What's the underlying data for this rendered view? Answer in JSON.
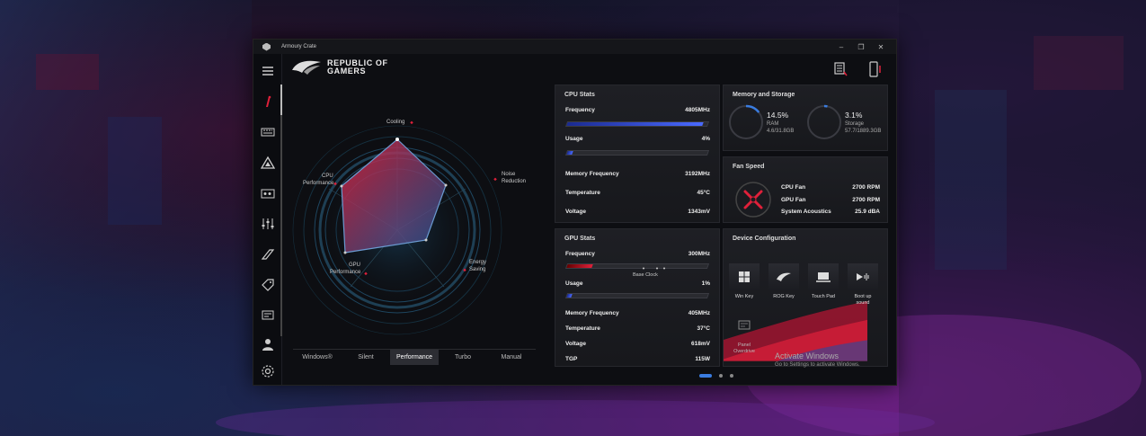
{
  "window": {
    "title": "Armoury Crate",
    "controls": [
      "–",
      "❐",
      "✕"
    ]
  },
  "brand": {
    "line1": "REPUBLIC OF",
    "line2": "GAMERS"
  },
  "sidebar": {
    "items": [
      {
        "icon": "menu-icon"
      },
      {
        "icon": "home-icon"
      },
      {
        "icon": "keyboard-icon"
      },
      {
        "icon": "aura-icon"
      },
      {
        "icon": "gamevisual-icon"
      },
      {
        "icon": "equalizer-icon"
      },
      {
        "icon": "scenario-icon"
      },
      {
        "icon": "deals-icon"
      },
      {
        "icon": "content-icon"
      },
      {
        "icon": "user-icon"
      },
      {
        "icon": "settings-icon"
      }
    ]
  },
  "radar": {
    "labels": {
      "cooling": "Cooling",
      "noise": [
        "Noise",
        "Reduction"
      ],
      "energy": [
        "Energy",
        "Saving"
      ],
      "gpu": [
        "GPU",
        "Performance"
      ],
      "cpu": [
        "CPU",
        "Performance"
      ]
    }
  },
  "modes": {
    "items": [
      "Windows®",
      "Silent",
      "Performance",
      "Turbo",
      "Manual"
    ],
    "selected": "Performance"
  },
  "cpu_stats": {
    "title": "CPU Stats",
    "frequency_label": "Frequency",
    "frequency_value": "4805MHz",
    "frequency_fill": 0.97,
    "usage_label": "Usage",
    "usage_value": "4%",
    "usage_fill": 0.04,
    "memfreq_label": "Memory Frequency",
    "memfreq_value": "3192MHz",
    "temp_label": "Temperature",
    "temp_value": "45°C",
    "voltage_label": "Voltage",
    "voltage_value": "1343mV"
  },
  "gpu_stats": {
    "title": "GPU Stats",
    "frequency_label": "Frequency",
    "frequency_value": "300MHz",
    "frequency_fill": 0.18,
    "base_clock": "Base Clock",
    "usage_label": "Usage",
    "usage_value": "1%",
    "usage_fill": 0.01,
    "memfreq_label": "Memory Frequency",
    "memfreq_value": "405MHz",
    "temp_label": "Temperature",
    "temp_value": "37°C",
    "voltage_label": "Voltage",
    "voltage_value": "618mV",
    "tgp_label": "TGP",
    "tgp_value": "115W"
  },
  "memory": {
    "title": "Memory and Storage",
    "ram_pct": "14.5%",
    "ram_label": "RAM",
    "ram_detail": "4.6/31.8GB",
    "ram_fill": 0.145,
    "storage_pct": "3.1%",
    "storage_label": "Storage",
    "storage_detail": "57.7/1889.3GB",
    "storage_fill": 0.031
  },
  "fan": {
    "title": "Fan Speed",
    "cpu_label": "CPU Fan",
    "cpu_value": "2700 RPM",
    "gpu_label": "GPU Fan",
    "gpu_value": "2700 RPM",
    "acoustics_label": "System Acoustics",
    "acoustics_value": "25.9 dBA"
  },
  "device": {
    "title": "Device Configuration",
    "items": [
      {
        "label": "Win Key",
        "icon": "windows-key-icon"
      },
      {
        "label": "ROG Key",
        "icon": "rog-key-icon"
      },
      {
        "label": "Touch Pad",
        "icon": "touchpad-icon"
      },
      {
        "label": "Boot up sound",
        "icon": "boot-sound-icon"
      },
      {
        "label": "Panel Overdrive",
        "icon": "panel-overdrive-icon"
      }
    ]
  },
  "watermark": {
    "line1": "Activate Windows",
    "line2": "Go to Settings to activate Windows."
  },
  "colors": {
    "accent_red": "#e0203a",
    "accent_blue": "#3a7ce0",
    "bg": "#0d0e12"
  }
}
